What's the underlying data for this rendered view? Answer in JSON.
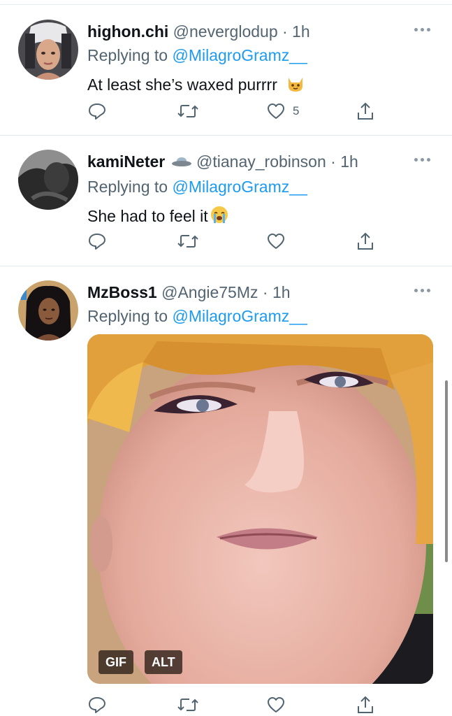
{
  "tweets": [
    {
      "display_name": "highon.chi",
      "handle": "@neverglodup",
      "time": "· 1h",
      "replying_prefix": "Replying to ",
      "replying_handle": "@MilagroGramz__",
      "text": "At least she’s waxed purrrr",
      "text_emoji": "🐱",
      "likes": "5"
    },
    {
      "display_name": "kamiNeter",
      "name_emoji": "🛸",
      "handle": "@tianay_robinson",
      "time": "· 1h",
      "replying_prefix": "Replying to ",
      "replying_handle": "@MilagroGramz__",
      "text": "She had to feel it",
      "text_emoji": "😭",
      "likes": ""
    },
    {
      "display_name": "MzBoss1",
      "handle": "@Angie75Mz",
      "time": "· 1h",
      "replying_prefix": "Replying to ",
      "replying_handle": "@MilagroGramz__",
      "media_badges": [
        "GIF",
        "ALT"
      ]
    }
  ],
  "icons": {
    "reply": "reply-icon",
    "retweet": "retweet-icon",
    "like": "heart-icon",
    "share": "share-icon",
    "more": "more-icon"
  },
  "colors": {
    "link": "#1d9bf0",
    "secondary": "#536471",
    "primary_text": "#0f1419",
    "divider": "#e1e8ed"
  }
}
